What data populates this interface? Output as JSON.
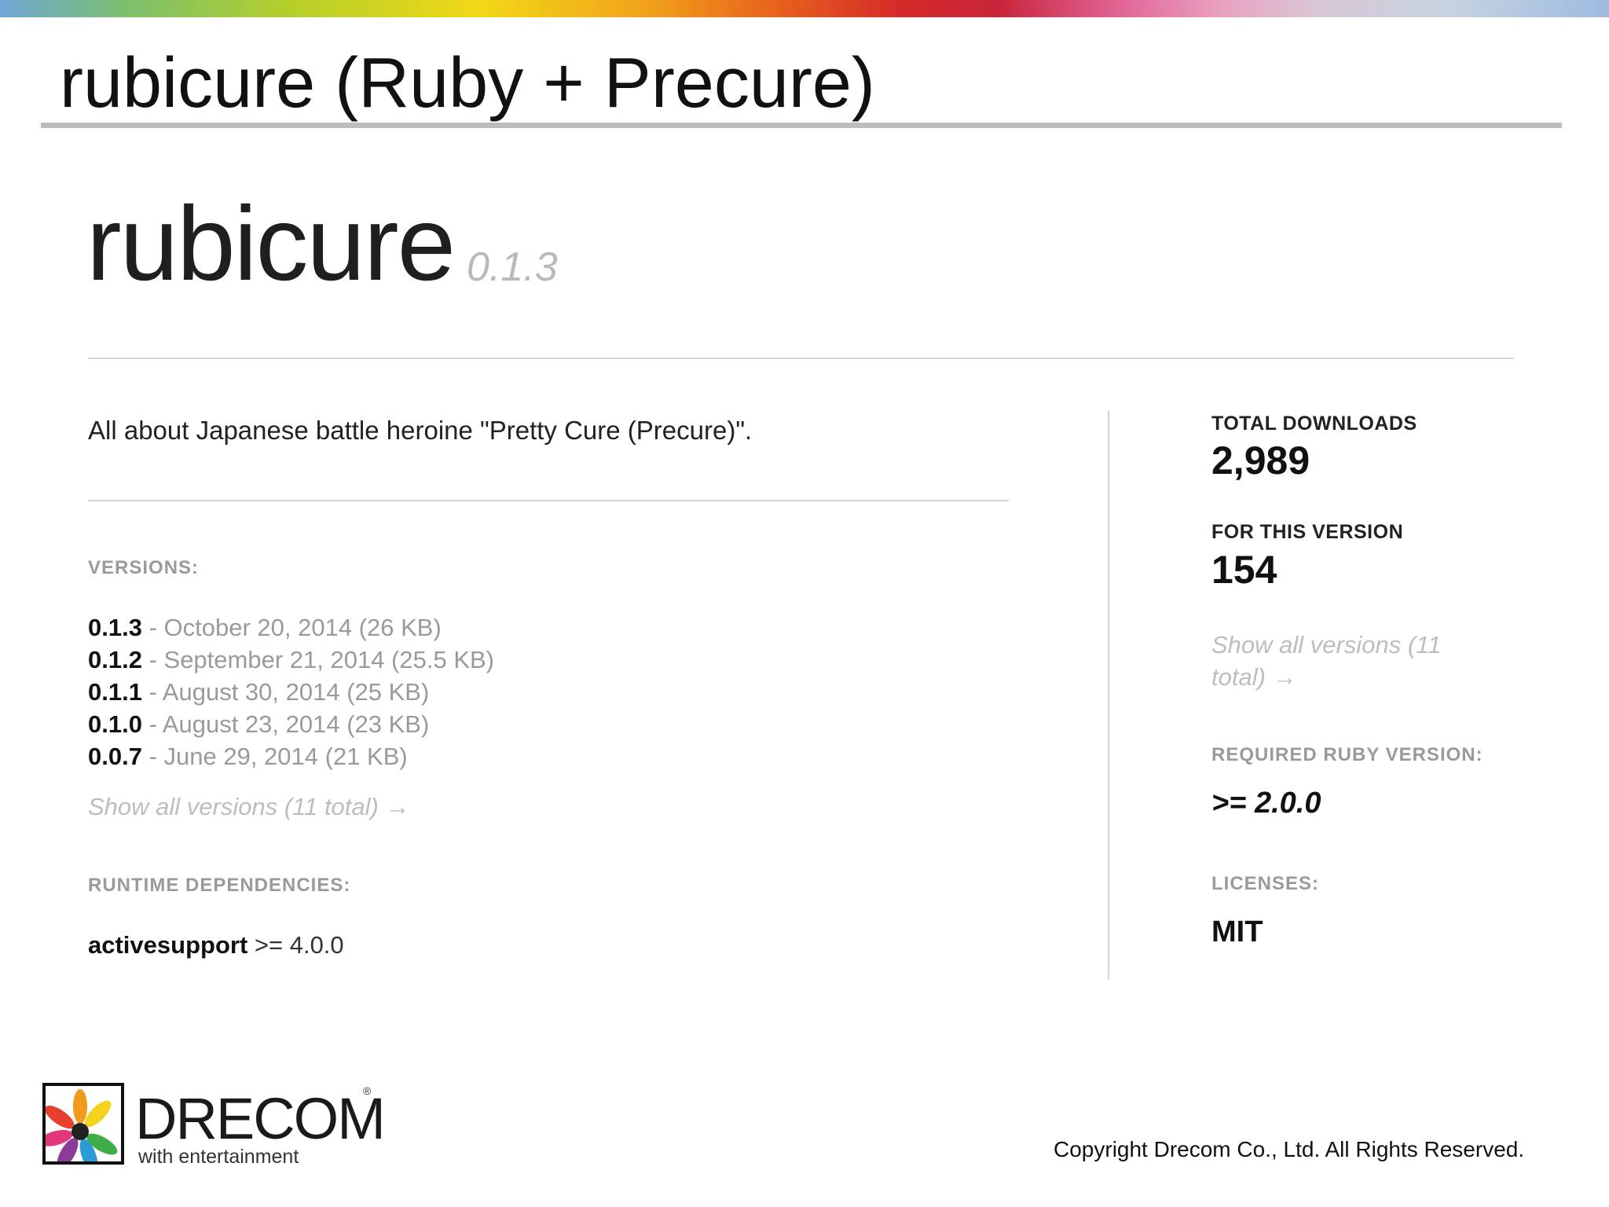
{
  "slide": {
    "title": "rubicure (Ruby + Precure)"
  },
  "gem": {
    "name": "rubicure",
    "version": "0.1.3",
    "description": "All about Japanese battle heroine \"Pretty Cure (Precure)\".",
    "versions_label": "VERSIONS:",
    "versions": [
      {
        "number": "0.1.3",
        "separator": " - ",
        "info": "October 20, 2014 (26 KB)"
      },
      {
        "number": "0.1.2",
        "separator": " - ",
        "info": "September 21, 2014 (25.5 KB)"
      },
      {
        "number": "0.1.1",
        "separator": " - ",
        "info": "August 30, 2014 (25 KB)"
      },
      {
        "number": "0.1.0",
        "separator": " - ",
        "info": "August 23, 2014 (23 KB)"
      },
      {
        "number": "0.0.7",
        "separator": " - ",
        "info": "June 29, 2014 (21 KB)"
      }
    ],
    "show_all_versions": "Show all versions (11 total) →",
    "runtime_dependencies_label": "RUNTIME DEPENDENCIES:",
    "dependency": {
      "name": "activesupport",
      "requirement": " >= 4.0.0"
    }
  },
  "sidebar": {
    "total_downloads_label": "TOTAL DOWNLOADS",
    "total_downloads": "2,989",
    "this_version_label": "FOR THIS VERSION",
    "this_version_downloads": "154",
    "show_all_versions": "Show all versions (11 total) →",
    "required_ruby_label": "REQUIRED RUBY VERSION:",
    "required_ruby": ">= 2.0.0",
    "licenses_label": "LICENSES:",
    "license": "MIT"
  },
  "footer": {
    "logo_text": "DRECOM",
    "logo_registered": "®",
    "logo_tagline": "with entertainment",
    "copyright": "Copyright Drecom Co., Ltd. All Rights Reserved."
  },
  "colors": {
    "muted_text": "#9a9a9a",
    "link_muted": "#bdbdbd",
    "rule": "#d6d6d6"
  }
}
